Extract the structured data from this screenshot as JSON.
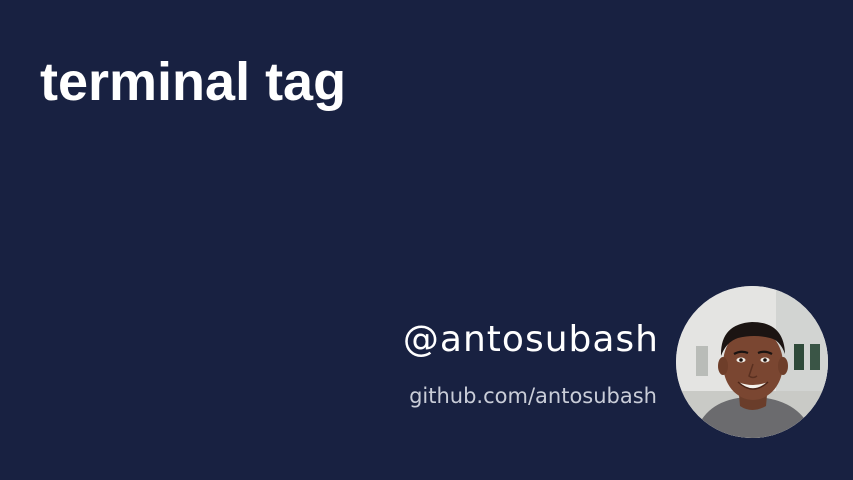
{
  "slide": {
    "title": "terminal tag",
    "handle": "@antosubash",
    "github": "github.com/antosubash"
  },
  "colors": {
    "background": "#182141",
    "title_text": "#ffffff",
    "handle_text": "#ffffff",
    "github_text": "#c9cdd8"
  },
  "avatar": {
    "icon": "profile-photo"
  }
}
